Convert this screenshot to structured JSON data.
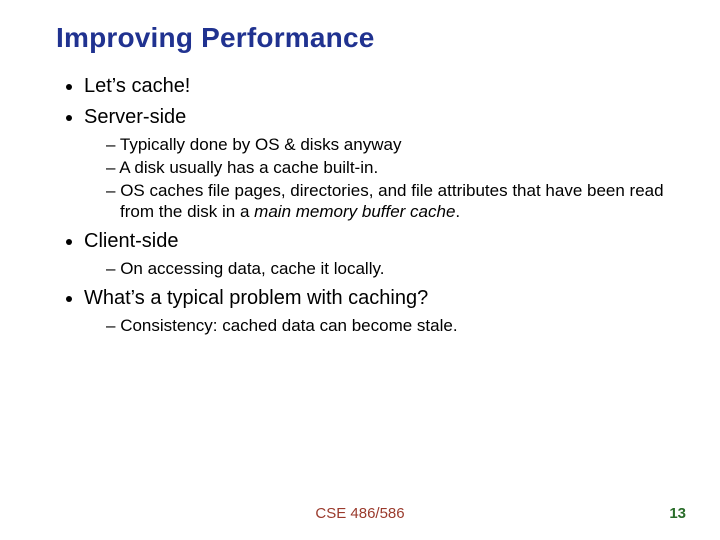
{
  "title": "Improving Performance",
  "bullets": {
    "b1": "Let’s cache!",
    "b2": "Server-side",
    "b2_sub": {
      "s1": "Typically done by OS & disks anyway",
      "s2": "A disk usually has a cache built-in.",
      "s3_pre": "OS caches file pages, directories, and file attributes that have been read from the disk in a ",
      "s3_italic": "main memory buffer cache",
      "s3_post": "."
    },
    "b3": "Client-side",
    "b3_sub": {
      "s1": "On accessing data, cache it locally."
    },
    "b4": "What’s a typical problem with caching?",
    "b4_sub": {
      "s1": "Consistency: cached data can become stale."
    }
  },
  "footer": {
    "course": "CSE 486/586",
    "page": "13"
  }
}
